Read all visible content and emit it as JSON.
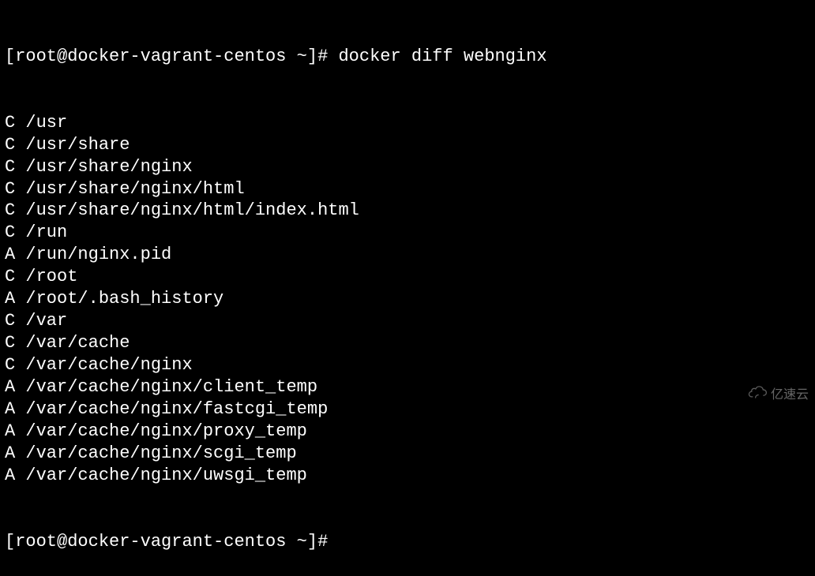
{
  "prompt": {
    "user": "root",
    "host": "docker-vagrant-centos",
    "cwd_symbol": "~",
    "prompt_char": "#"
  },
  "command": "docker diff webnginx",
  "diff": [
    {
      "flag": "C",
      "path": "/usr"
    },
    {
      "flag": "C",
      "path": "/usr/share"
    },
    {
      "flag": "C",
      "path": "/usr/share/nginx"
    },
    {
      "flag": "C",
      "path": "/usr/share/nginx/html"
    },
    {
      "flag": "C",
      "path": "/usr/share/nginx/html/index.html"
    },
    {
      "flag": "C",
      "path": "/run"
    },
    {
      "flag": "A",
      "path": "/run/nginx.pid"
    },
    {
      "flag": "C",
      "path": "/root"
    },
    {
      "flag": "A",
      "path": "/root/.bash_history"
    },
    {
      "flag": "C",
      "path": "/var"
    },
    {
      "flag": "C",
      "path": "/var/cache"
    },
    {
      "flag": "C",
      "path": "/var/cache/nginx"
    },
    {
      "flag": "A",
      "path": "/var/cache/nginx/client_temp"
    },
    {
      "flag": "A",
      "path": "/var/cache/nginx/fastcgi_temp"
    },
    {
      "flag": "A",
      "path": "/var/cache/nginx/proxy_temp"
    },
    {
      "flag": "A",
      "path": "/var/cache/nginx/scgi_temp"
    },
    {
      "flag": "A",
      "path": "/var/cache/nginx/uwsgi_temp"
    }
  ],
  "watermark": "亿速云"
}
